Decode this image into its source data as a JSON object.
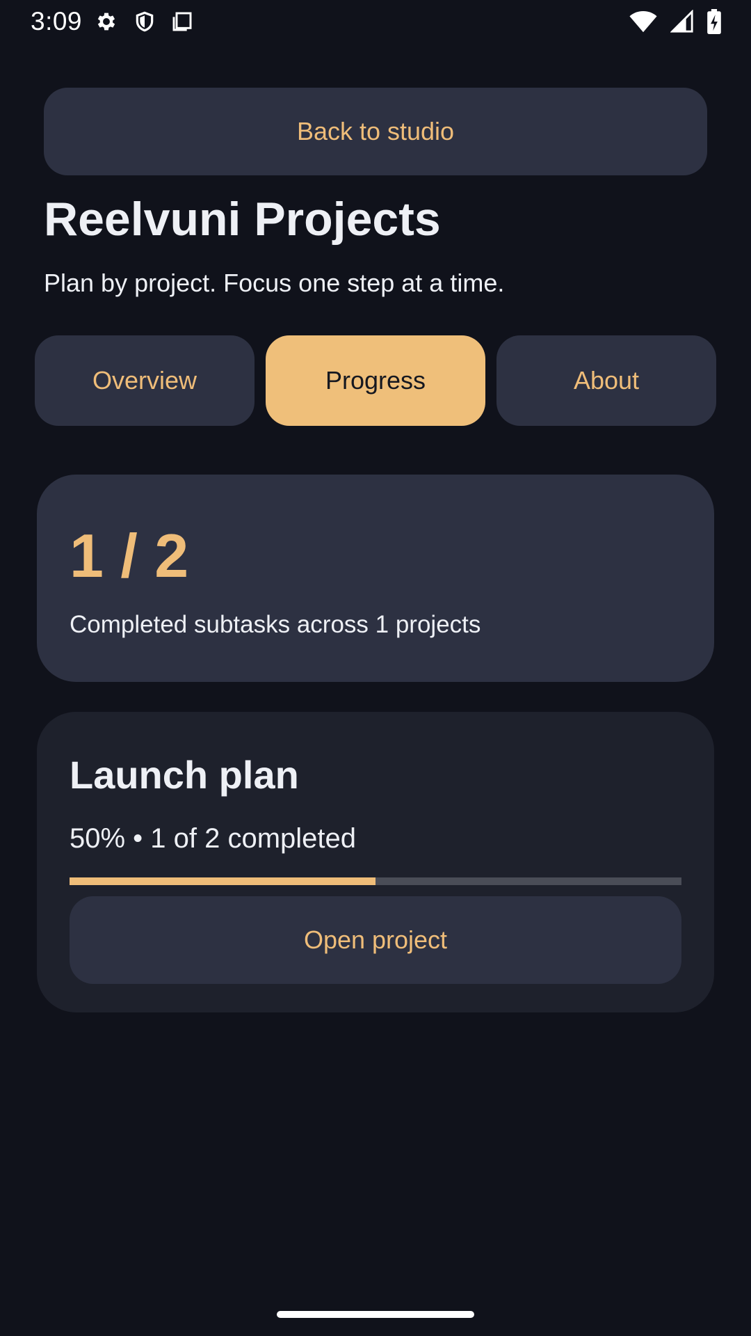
{
  "status_bar": {
    "time": "3:09",
    "icons": [
      "gear-icon",
      "shield-icon",
      "copy-icon"
    ],
    "right_icons": [
      "wifi-icon",
      "signal-icon",
      "battery-charging-icon"
    ]
  },
  "header": {
    "back_label": "Back to studio",
    "title": "Reelvuni Projects",
    "subtitle": "Plan by project. Focus one step at a time."
  },
  "tabs": [
    {
      "label": "Overview",
      "active": false
    },
    {
      "label": "Progress",
      "active": true
    },
    {
      "label": "About",
      "active": false
    }
  ],
  "summary": {
    "count": "1 / 2",
    "caption": "Completed subtasks across 1 projects"
  },
  "project": {
    "name": "Launch plan",
    "status": "50% • 1 of 2 completed",
    "progress": 0.5,
    "open_label": "Open project"
  },
  "colors": {
    "background": "#10121b",
    "surface": "#2d3142",
    "card": "#1e212c",
    "accent": "#efbd79",
    "text": "#eef0f5",
    "track": "#4a4d57"
  }
}
